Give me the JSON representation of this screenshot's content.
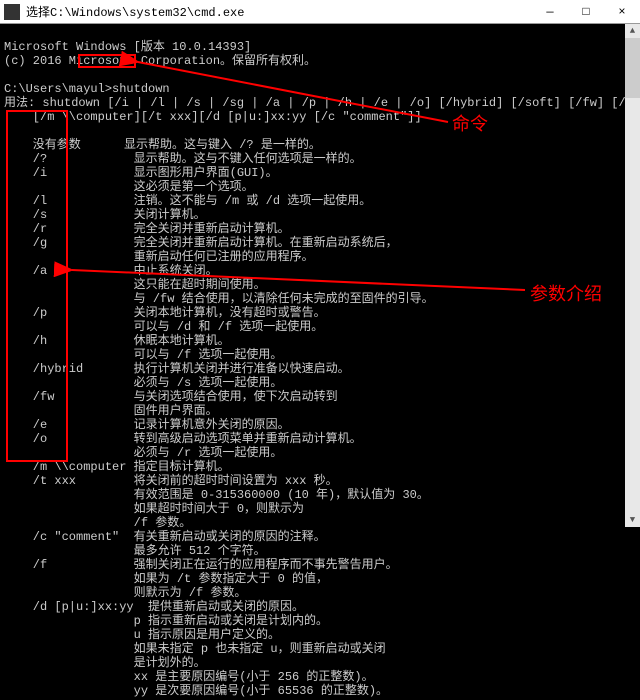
{
  "window": {
    "title": "选择C:\\Windows\\system32\\cmd.exe",
    "minimize": "—",
    "maximize": "□",
    "close": "×"
  },
  "term": {
    "l1": "Microsoft Windows [版本 10.0.14393]",
    "l2": "(c) 2016 Microsoft Corporation。保留所有权利。",
    "l3": "",
    "l4": "C:\\Users\\mayul>shutdown",
    "l5": "用法: shutdown [/i | /l | /s | /sg | /a | /p | /h | /e | /o] [/hybrid] [/soft] [/fw] [/f]",
    "l6": "    [/m \\\\computer][/t xxx][/d [p|u:]xx:yy [/c \"comment\"]]",
    "l7": "",
    "l8": "    没有参数      显示帮助。这与键入 /? 是一样的。",
    "l9": "    /?            显示帮助。这与不键入任何选项是一样的。",
    "l10": "    /i            显示图形用户界面(GUI)。",
    "l11": "                  这必须是第一个选项。",
    "l12": "    /l            注销。这不能与 /m 或 /d 选项一起使用。",
    "l13": "    /s            关闭计算机。",
    "l14": "    /r            完全关闭并重新启动计算机。",
    "l15": "    /g            完全关闭并重新启动计算机。在重新启动系统后，",
    "l16": "                  重新启动任何已注册的应用程序。",
    "l17": "    /a            中止系统关闭。",
    "l18": "                  这只能在超时期间使用。",
    "l19": "                  与 /fw 结合使用，以清除任何未完成的至固件的引导。",
    "l20": "    /p            关闭本地计算机，没有超时或警告。",
    "l21": "                  可以与 /d 和 /f 选项一起使用。",
    "l22": "    /h            休眠本地计算机。",
    "l23": "                  可以与 /f 选项一起使用。",
    "l24": "    /hybrid       执行计算机关闭并进行准备以快速启动。",
    "l25": "                  必须与 /s 选项一起使用。",
    "l26": "    /fw           与关闭选项结合使用，使下次启动转到",
    "l27": "                  固件用户界面。",
    "l28": "    /e            记录计算机意外关闭的原因。",
    "l29": "    /o            转到高级启动选项菜单并重新启动计算机。",
    "l30": "                  必须与 /r 选项一起使用。",
    "l31": "    /m \\\\computer 指定目标计算机。",
    "l32": "    /t xxx        将关闭前的超时时间设置为 xxx 秒。",
    "l33": "                  有效范围是 0-315360000 (10 年)，默认值为 30。",
    "l34": "                  如果超时时间大于 0，则默示为",
    "l35": "                  /f 参数。",
    "l36": "    /c \"comment\"  有关重新启动或关闭的原因的注释。",
    "l37": "                  最多允许 512 个字符。",
    "l38": "    /f            强制关闭正在运行的应用程序而不事先警告用户。",
    "l39": "                  如果为 /t 参数指定大于 0 的值，",
    "l40": "                  则默示为 /f 参数。",
    "l41": "    /d [p|u:]xx:yy  提供重新启动或关闭的原因。",
    "l42": "                  p 指示重新启动或关闭是计划内的。",
    "l43": "                  u 指示原因是用户定义的。",
    "l44": "                  如果未指定 p 也未指定 u，则重新启动或关闭",
    "l45": "                  是计划外的。",
    "l46": "                  xx 是主要原因编号(小于 256 的正整数)。",
    "l47": "                  yy 是次要原因编号(小于 65536 的正整数)。"
  },
  "ann": {
    "cmd": "命令",
    "param": "参数介绍"
  }
}
